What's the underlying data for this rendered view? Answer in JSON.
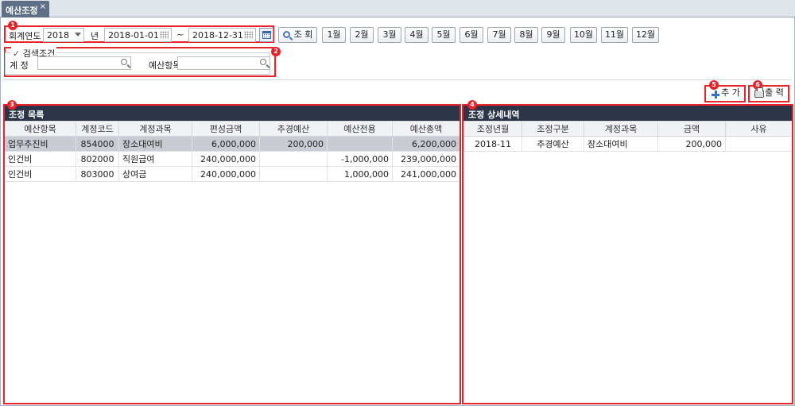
{
  "tab": {
    "title": "예산조정",
    "close": "×"
  },
  "filters": {
    "fiscal_year_label": "회계연도",
    "fiscal_year_value": "2018",
    "year_suffix": "년",
    "date_from": "2018-01-01",
    "tilde": "~",
    "date_to": "2018-12-31",
    "search_button": "조 회",
    "months": [
      "1월",
      "2월",
      "3월",
      "4월",
      "5월",
      "6월",
      "7월",
      "8월",
      "9월",
      "10월",
      "11월",
      "12월"
    ]
  },
  "search_conditions": {
    "legend": "검색조건",
    "checked": true,
    "account_label": "계 정",
    "account_value": "",
    "budget_item_label": "예산항목",
    "budget_item_value": ""
  },
  "actions": {
    "add": "추 가",
    "print": "출 력"
  },
  "badges": [
    "1",
    "2",
    "3",
    "4",
    "5",
    "6"
  ],
  "left_panel": {
    "title": "조정 목록",
    "columns": [
      "예산항목",
      "계정코드",
      "계정과목",
      "편성금액",
      "추경예산",
      "예산전용",
      "예산총액"
    ],
    "rows": [
      [
        "업무추진비",
        "854000",
        "장소대여비",
        "6,000,000",
        "200,000",
        "",
        "6,200,000"
      ],
      [
        "인건비",
        "802000",
        "직원급여",
        "240,000,000",
        "",
        "-1,000,000",
        "239,000,000"
      ],
      [
        "인건비",
        "803000",
        "상여금",
        "240,000,000",
        "",
        "1,000,000",
        "241,000,000"
      ]
    ],
    "selected_row": 0
  },
  "right_panel": {
    "title": "조정 상세내역",
    "columns": [
      "조정년월",
      "조정구분",
      "계정과목",
      "금액",
      "사유"
    ],
    "rows": [
      [
        "2018-11",
        "추경예산",
        "장소대여비",
        "200,000",
        ""
      ]
    ]
  },
  "colors": {
    "annotation": "#e8232a",
    "panel_header": "#2b3547",
    "tab": "#5f6f86",
    "selected_row": "#c9ccd2"
  }
}
